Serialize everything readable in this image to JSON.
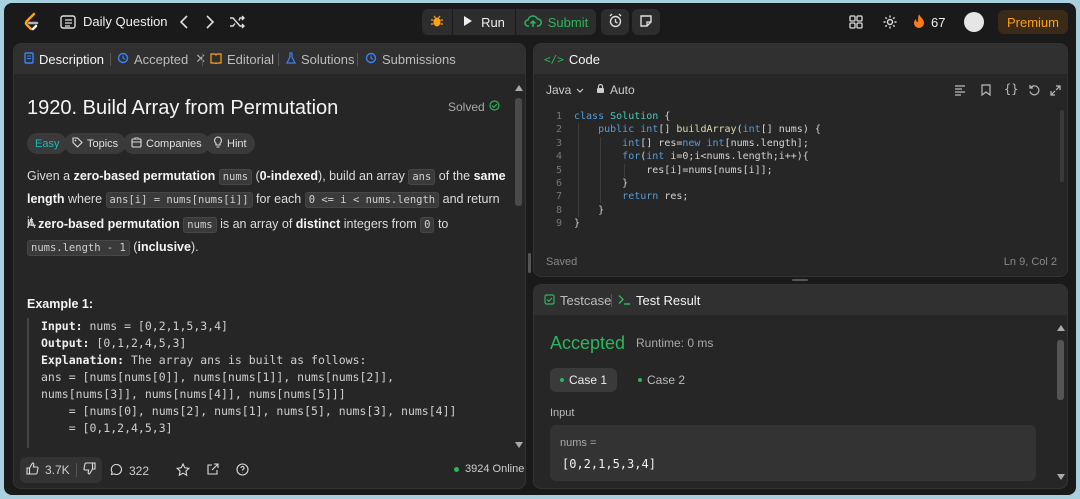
{
  "topbar": {
    "title": "Daily Question",
    "run_label": "Run",
    "submit_label": "Submit",
    "streak_count": "67",
    "premium_label": "Premium"
  },
  "left": {
    "tabs": [
      "Description",
      "Accepted",
      "Editorial",
      "Solutions",
      "Submissions"
    ],
    "problem_title": "1920. Build Array from Permutation",
    "solved_label": "Solved",
    "chips": [
      "Easy",
      "Topics",
      "Companies",
      "Hint"
    ],
    "p1": {
      "t1": "Given a ",
      "b1": "zero-based permutation",
      "c1": "nums",
      "t2": " (",
      "b2": "0-indexed",
      "t3": "), build an array ",
      "c2": "ans",
      "t4": " of the ",
      "b3": "same length",
      "t5": " where ",
      "c3": "ans[i] = nums[nums[i]]",
      "t6": " for each ",
      "c4": "0 <= i < nums.length",
      "t7": " and return it."
    },
    "p2": {
      "t1": "A ",
      "b1": "zero-based permutation",
      "t2": " ",
      "c1": "nums",
      "t3": " is an array of ",
      "b2": "distinct",
      "t4": " integers from ",
      "c2": "0",
      "t5": " to ",
      "c3": "nums.length - 1",
      "t6": " (",
      "b3": "inclusive",
      "t7": ")."
    },
    "example_title": "Example 1:",
    "example": {
      "input_label": "Input:",
      "input_val": " nums = [0,2,1,5,3,4]",
      "output_label": "Output:",
      "output_val": " [0,1,2,4,5,3]",
      "expl_label": "Explanation:",
      "expl_val": " The array ans is built as follows:",
      "l4": "ans = [nums[nums[0]], nums[nums[1]], nums[nums[2]],",
      "l5": "nums[nums[3]], nums[nums[4]], nums[nums[5]]]",
      "l6": "    = [nums[0], nums[2], nums[1], nums[5], nums[3], nums[4]]",
      "l7": "    = [0,1,2,4,5,3]"
    },
    "footer": {
      "likes": "3.7K",
      "comments": "322",
      "online": "3924 Online"
    }
  },
  "code": {
    "title": "Code",
    "language": "Java",
    "mode": "Auto",
    "status_left": "Saved",
    "status_right": "Ln 9, Col 2",
    "lines": [
      "class Solution {",
      "    public int[] buildArray(int[] nums) {",
      "        int[] res=new int[nums.length];",
      "        for(int i=0;i<nums.length;i++){",
      "            res[i]=nums[nums[i]];",
      "        }",
      "        return res;",
      "    }",
      "}"
    ],
    "line_numbers": [
      "1",
      "2",
      "3",
      "4",
      "5",
      "6",
      "7",
      "8",
      "9"
    ]
  },
  "test": {
    "tab_testcase": "Testcase",
    "tab_result": "Test Result",
    "verdict": "Accepted",
    "runtime": "Runtime: 0 ms",
    "cases": [
      "Case 1",
      "Case 2"
    ],
    "input_label": "Input",
    "input_name": "nums =",
    "input_value": "[0,2,1,5,3,4]"
  },
  "colors": {
    "accent_orange": "#ffa116",
    "accent_green": "#2db55d",
    "tab_blue": "#3b82f6"
  }
}
